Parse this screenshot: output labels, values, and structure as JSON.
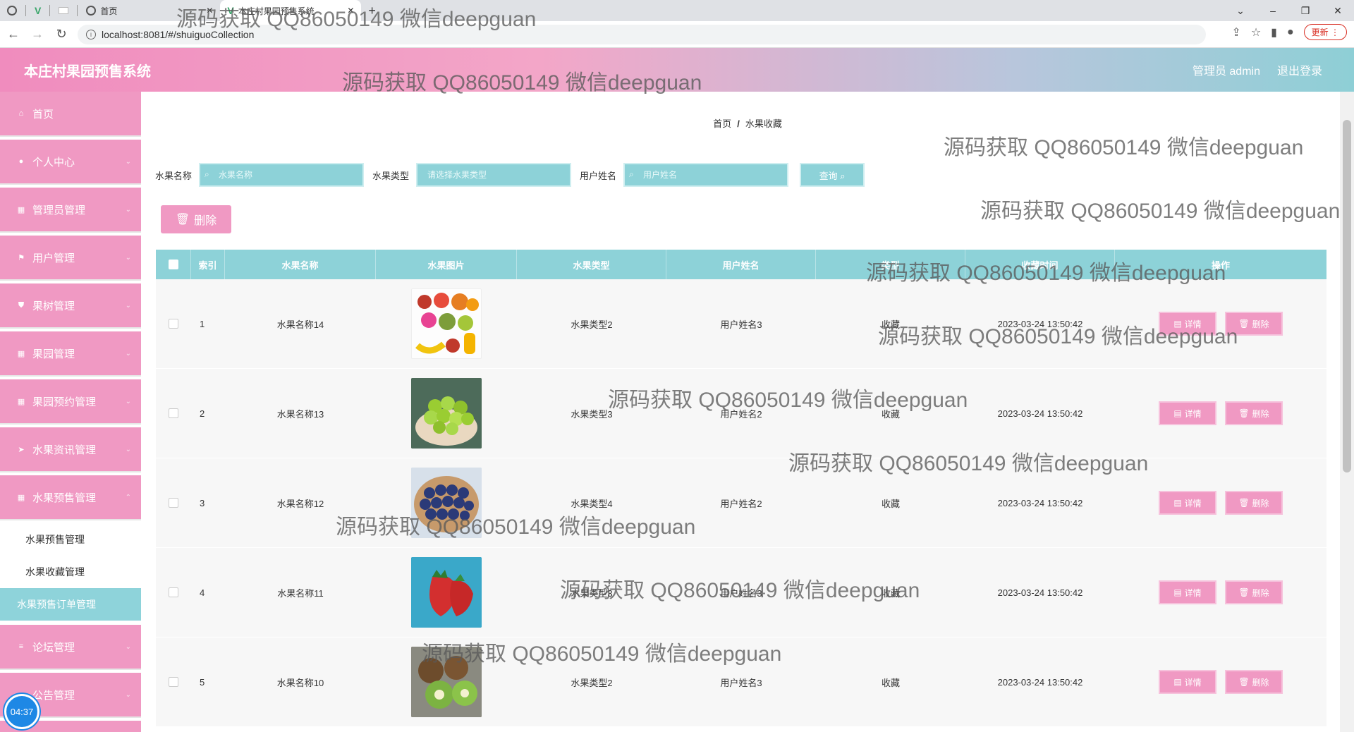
{
  "browser": {
    "tabs": [
      {
        "label": ""
      },
      {
        "label": ""
      },
      {
        "label": ""
      },
      {
        "label": "首页"
      },
      {
        "label": "本庄村果园预售系统"
      }
    ],
    "url": "localhost:8081/#/shuiguoCollection",
    "update_label": "更新"
  },
  "header": {
    "title": "本庄村果园预售系统",
    "user_label": "管理员 admin",
    "logout_label": "退出登录"
  },
  "sidebar": {
    "items": [
      {
        "label": "首页",
        "icon": "home-icon"
      },
      {
        "label": "个人中心",
        "icon": "user-icon"
      },
      {
        "label": "管理员管理",
        "icon": "grid-icon"
      },
      {
        "label": "用户管理",
        "icon": "flag-icon"
      },
      {
        "label": "果树管理",
        "icon": "shield-icon"
      },
      {
        "label": "果园管理",
        "icon": "grid-icon"
      },
      {
        "label": "果园预约管理",
        "icon": "grid-icon"
      },
      {
        "label": "水果资讯管理",
        "icon": "send-icon"
      },
      {
        "label": "水果预售管理",
        "icon": "grid-icon"
      }
    ],
    "submenu": [
      {
        "label": "水果预售管理"
      },
      {
        "label": "水果收藏管理"
      },
      {
        "label": "水果预售订单管理"
      }
    ],
    "bottom_items": [
      {
        "label": "论坛管理",
        "icon": "list-icon"
      },
      {
        "label": "公告管理",
        "icon": "bell-icon"
      }
    ],
    "clock": "04:37"
  },
  "breadcrumb": {
    "home": "首页",
    "current": "水果收藏"
  },
  "search": {
    "name_label": "水果名称",
    "name_placeholder": "水果名称",
    "type_label": "水果类型",
    "type_placeholder": "请选择水果类型",
    "user_label": "用户姓名",
    "user_placeholder": "用户姓名",
    "query_label": "查询"
  },
  "toolbar": {
    "delete_label": "删除"
  },
  "table": {
    "headers": [
      "索引",
      "水果名称",
      "水果图片",
      "水果类型",
      "用户姓名",
      "类型",
      "收藏时间",
      "操作"
    ],
    "detail_label": "详情",
    "delete_label": "删除",
    "rows": [
      {
        "index": "1",
        "name": "水果名称14",
        "image": "mixed-fruits",
        "type": "水果类型2",
        "user": "用户姓名3",
        "status": "收藏",
        "time": "2023-03-24 13:50:42"
      },
      {
        "index": "2",
        "name": "水果名称13",
        "image": "green-grapes",
        "type": "水果类型3",
        "user": "用户姓名2",
        "status": "收藏",
        "time": "2023-03-24 13:50:42"
      },
      {
        "index": "3",
        "name": "水果名称12",
        "image": "blueberries",
        "type": "水果类型4",
        "user": "用户姓名2",
        "status": "收藏",
        "time": "2023-03-24 13:50:42"
      },
      {
        "index": "4",
        "name": "水果名称11",
        "image": "strawberries",
        "type": "水果类型3",
        "user": "用户姓名3",
        "status": "收藏",
        "time": "2023-03-24 13:50:42"
      },
      {
        "index": "5",
        "name": "水果名称10",
        "image": "kiwis",
        "type": "水果类型2",
        "user": "用户姓名3",
        "status": "收藏",
        "time": "2023-03-24 13:50:42"
      }
    ]
  },
  "watermark": "源码获取 QQ86050149 微信deepguan",
  "colors": {
    "pink": "#f099c3",
    "teal": "#8dd2d8"
  }
}
